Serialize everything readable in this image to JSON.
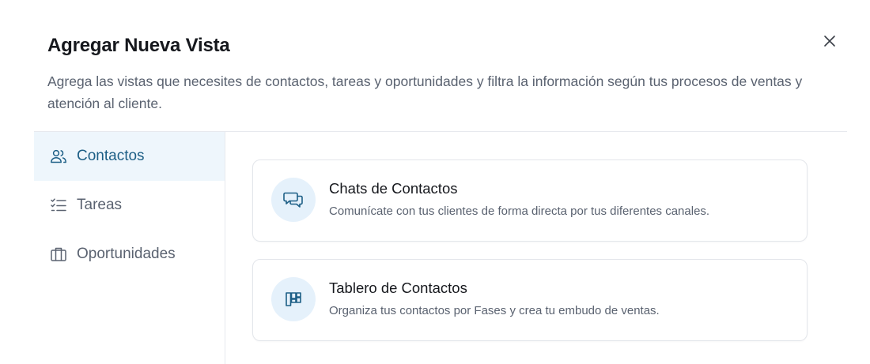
{
  "dialog": {
    "title": "Agregar Nueva Vista",
    "subtitle": "Agrega las vistas que necesites de contactos, tareas y oportunidades y filtra la información según tus procesos de ventas y atención al cliente."
  },
  "sidebar": {
    "items": [
      {
        "label": "Contactos",
        "icon": "users-icon",
        "active": true
      },
      {
        "label": "Tareas",
        "icon": "task-list-icon",
        "active": false
      },
      {
        "label": "Oportunidades",
        "icon": "briefcase-icon",
        "active": false
      }
    ]
  },
  "views": [
    {
      "title": "Chats de Contactos",
      "description": "Comunícate con tus clientes de forma directa por tus diferentes canales.",
      "icon": "chat-bubbles-icon"
    },
    {
      "title": "Tablero de Contactos",
      "description": "Organiza tus contactos por Fases y crea tu embudo de ventas.",
      "icon": "kanban-board-icon"
    }
  ],
  "colors": {
    "accent": "#1d5f86",
    "active_background": "#eef6fc",
    "icon_circle": "#e5f1fb",
    "muted_text": "#5a6270",
    "border": "#e3e6eb"
  }
}
